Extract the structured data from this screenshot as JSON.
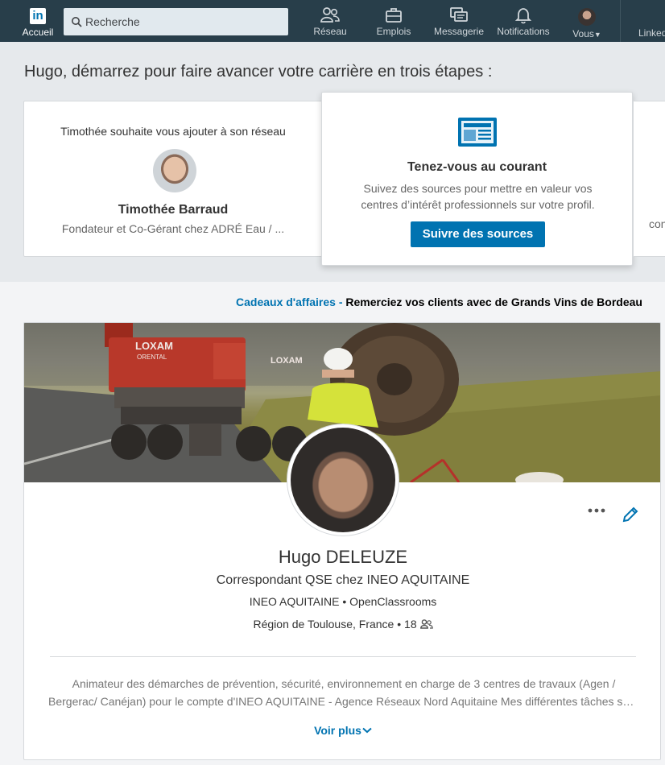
{
  "nav": {
    "logo_text": "in",
    "home_label": "Accueil",
    "search_placeholder": "Recherche",
    "items": [
      {
        "label": "Réseau",
        "icon": "network-icon"
      },
      {
        "label": "Emplois",
        "icon": "briefcase-icon"
      },
      {
        "label": "Messagerie",
        "icon": "messaging-icon"
      },
      {
        "label": "Notifications",
        "icon": "bell-icon"
      },
      {
        "label": "Vous",
        "icon": "avatar"
      }
    ],
    "overflow_label": "Linked"
  },
  "onboarding": {
    "title": "Hugo, démarrez pour faire avancer votre carrière en trois étapes :",
    "card1": {
      "intro": "Timothée souhaite vous ajouter à son réseau",
      "name": "Timothée Barraud",
      "subtitle": "Fondateur et Co-Gérant chez ADRÉ Eau / ..."
    },
    "card2": {
      "title": "Tenez-vous au courant",
      "description": "Suivez des sources pour mettre en valeur vos centres d’intérêt professionnels sur votre profil.",
      "button": "Suivre des sources"
    },
    "card3": {
      "peek": "con"
    }
  },
  "ad": {
    "link": "Cadeaux d'affaires",
    "separator": " - ",
    "text": "Remerciez vos clients avec de Grands Vins de Bordeau"
  },
  "banner": {
    "machine_brand": "LOXAM",
    "machine_sub": "ORENTAL"
  },
  "profile": {
    "name": "Hugo DELEUZE",
    "headline": "Correspondant QSE chez INEO AQUITAINE",
    "company": "INEO AQUITAINE",
    "school": "OpenClassrooms",
    "location": "Région de Toulouse, France",
    "connections": "18",
    "dot": "•",
    "summary_line1": "Animateur des démarches de prévention, sécurité, environnement en charge de 3 centres de travaux (Agen /",
    "summary_line2": "Bergerac/ Canéjan) pour le compte d'INEO AQUITAINE - Agence Réseaux Nord Aquitaine Mes différentes tâches son…",
    "see_more": "Voir plus"
  },
  "colors": {
    "nav_bg": "#283e4a",
    "accent": "#0073b1"
  }
}
